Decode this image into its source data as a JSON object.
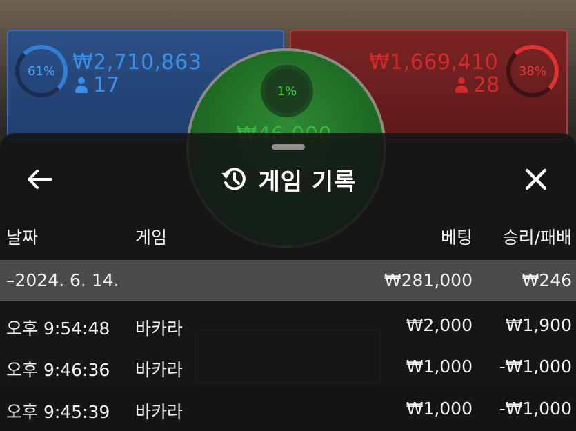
{
  "board": {
    "player": {
      "percent": "61%",
      "amount": "₩2,710,863",
      "count": "17",
      "color": "#3b8fe8"
    },
    "banker": {
      "percent": "38%",
      "amount": "₩1,669,410",
      "count": "28",
      "color": "#d22b2b"
    },
    "tie": {
      "percent": "1%",
      "amount": "₩46,000",
      "color": "#35b83b"
    }
  },
  "sheet": {
    "title": "게임 기록",
    "icons": {
      "back": "arrow-left-icon",
      "history": "history-icon",
      "close": "close-icon"
    },
    "columns": {
      "date": "날짜",
      "game": "게임",
      "bet": "베팅",
      "result": "승리/패배"
    },
    "date_group": {
      "label": "–2024. 6. 14.",
      "bet": "₩281,000",
      "result": "₩246"
    },
    "rows": [
      {
        "time": "오후 9:54:48",
        "game": "바카라",
        "bet": "₩2,000",
        "result": "₩1,900"
      },
      {
        "time": "오후 9:46:36",
        "game": "바카라",
        "bet": "₩1,000",
        "result": "-₩1,000"
      },
      {
        "time": "오후 9:45:39",
        "game": "바카라",
        "bet": "₩1,000",
        "result": "-₩1,000"
      }
    ]
  }
}
